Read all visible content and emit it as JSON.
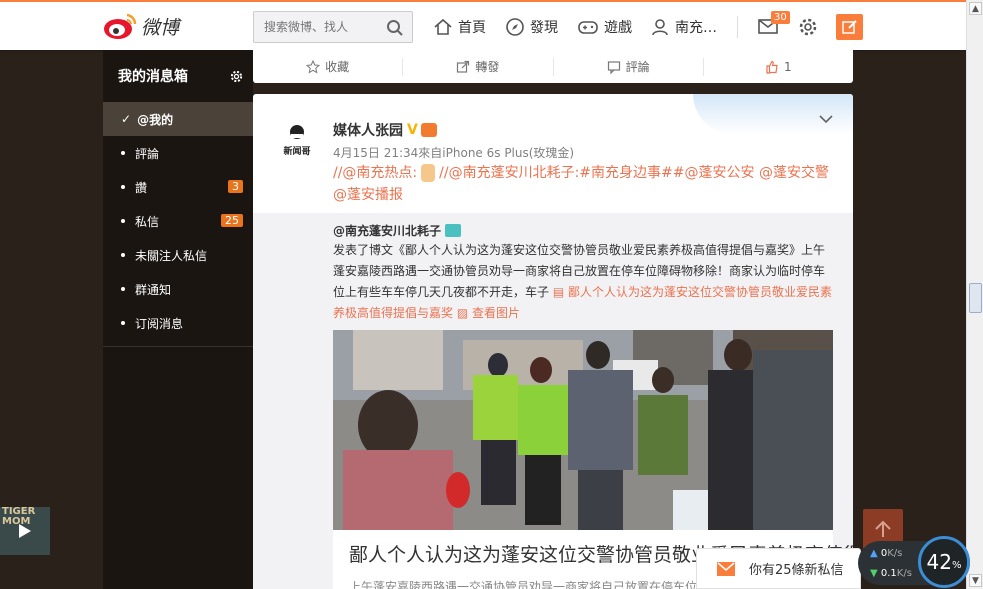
{
  "header": {
    "logo_text": "微博",
    "search_placeholder": "搜索微博、找人",
    "nav": [
      {
        "label": "首頁",
        "icon": "home-icon"
      },
      {
        "label": "發現",
        "icon": "compass-icon"
      },
      {
        "label": "遊戲",
        "icon": "gamepad-icon"
      },
      {
        "label": "南充…",
        "icon": "user-icon"
      }
    ],
    "messages_count": "30"
  },
  "sidebar": {
    "title": "我的消息箱",
    "items": [
      {
        "label": "@我的",
        "count": ""
      },
      {
        "label": "評論",
        "count": ""
      },
      {
        "label": "讚",
        "count": "3"
      },
      {
        "label": "私信",
        "count": "25"
      },
      {
        "label": "未關注人私信",
        "count": ""
      },
      {
        "label": "群通知",
        "count": ""
      },
      {
        "label": "订阅消息",
        "count": ""
      }
    ]
  },
  "prev_actions": {
    "favorite": "收藏",
    "repost": "轉發",
    "comment": "評論",
    "like_count": "1"
  },
  "post": {
    "author": "媒体人张园",
    "avatar_text": "新闻哥",
    "meta": "4月15日 21:34來自iPhone 6s Plus(玫瑰金)",
    "text_a": "//@南充热点:",
    "text_b": "//@南充蓬安川北耗子:#南充身边事##@蓬安公安 @蓬安交警 @蓬安播报",
    "retweet": {
      "author": "@南充蓬安川北耗子",
      "text": "发表了博文《鄙人个人认为这为蓬安这位交警协管员敬业爱民素养极高值得提倡与嘉奖》上午蓬安嘉陵西路遇一交通协管员劝导一商家将自己放置在停车位障碍物移除！商家认为临时停车位上有些车车停几天几夜都不开走，车子",
      "link": "鄙人个人认为这为蓬安这位交警协管员敬业爱民素养极高值得提倡与嘉奖",
      "view_images": "查看图片",
      "article_title": "鄙人个人认为这为蓬安这位交警协管员敬业爱民素养极高值得提倡与嘉奖",
      "article_sub": "上午蓬安嘉陵西路遇一交通协管员劝导一商家将自己放置在停车位障碍物移除"
    }
  },
  "notification": {
    "text": "你有25條新私信"
  },
  "network": {
    "up": "0",
    "up_unit": "K/s",
    "down": "0.1",
    "down_unit": "K/s",
    "percent": "42",
    "percent_unit": "%"
  },
  "video": {
    "label": "TIGER MOM"
  }
}
